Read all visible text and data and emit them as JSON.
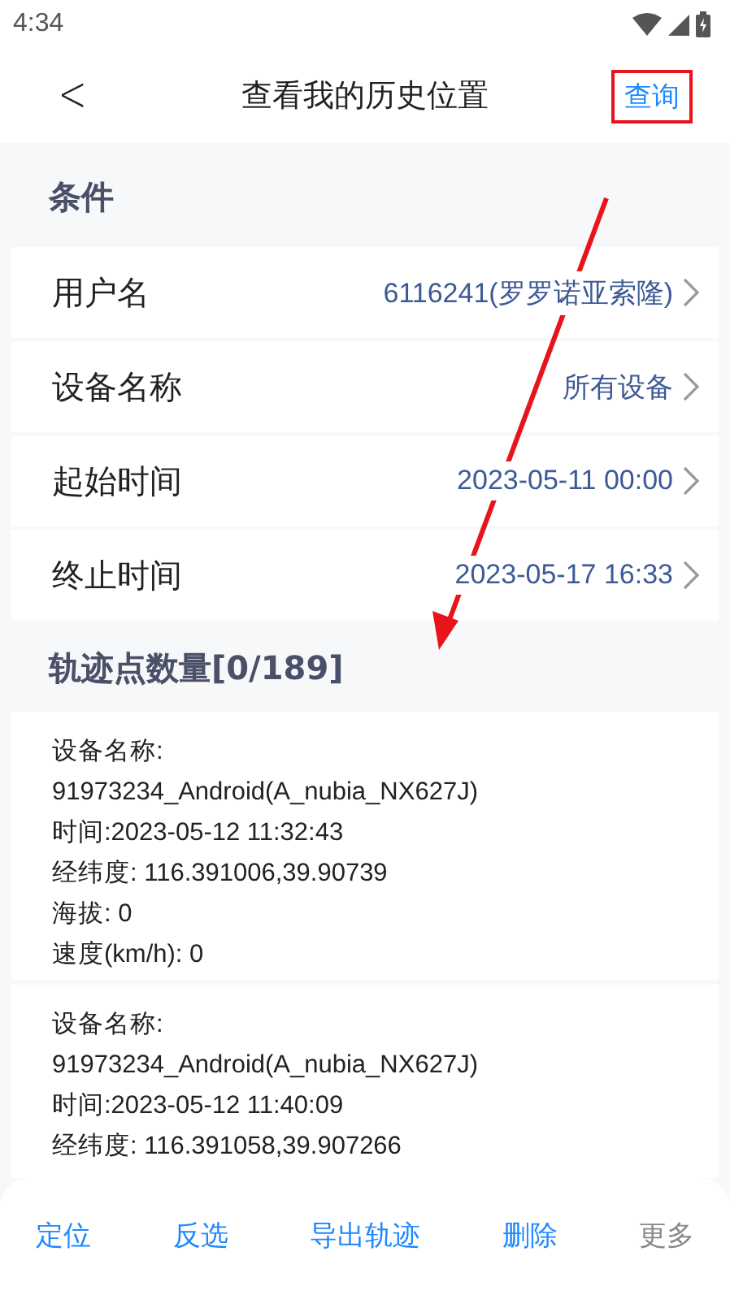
{
  "status_bar": {
    "time": "4:34"
  },
  "header": {
    "back": "<",
    "title": "查看我的历史位置",
    "action": {
      "label": "查询",
      "highlighted": true
    }
  },
  "annotation": {
    "kind": "arrow"
  },
  "conditions": {
    "title": "条件",
    "rows": [
      {
        "label": "用户名",
        "value": "6116241(罗罗诺亚索隆)"
      },
      {
        "label": "设备名称",
        "value": "所有设备"
      },
      {
        "label": "起始时间",
        "value": "2023-05-11 00:00"
      },
      {
        "label": "终止时间",
        "value": "2023-05-17 16:33"
      }
    ]
  },
  "points": {
    "title": "轨迹点数量[0/189]",
    "records": [
      {
        "lines": [
          "设备名称:",
          "91973234_Android(A_nubia_NX627J)",
          "时间:2023-05-12 11:32:43",
          "经纬度: 116.391006,39.90739",
          "海拔: 0",
          "速度(km/h): 0"
        ]
      },
      {
        "lines": [
          "设备名称:",
          "91973234_Android(A_nubia_NX627J)",
          "时间:2023-05-12 11:40:09",
          "经纬度: 116.391058,39.907266"
        ]
      }
    ]
  },
  "actions": [
    {
      "label": "定位",
      "disabled": false
    },
    {
      "label": "反选",
      "disabled": false
    },
    {
      "label": "导出轨迹",
      "disabled": false
    },
    {
      "label": "删除",
      "disabled": false
    },
    {
      "label": "更多",
      "disabled": true
    }
  ]
}
